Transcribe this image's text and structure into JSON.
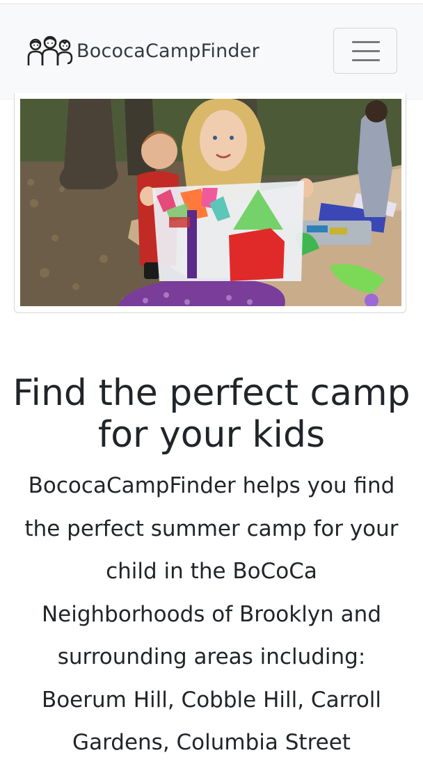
{
  "navbar": {
    "brand_name": "BococaCampFinder",
    "logo_icon": "family-icon",
    "menu_icon": "hamburger-icon"
  },
  "hero": {
    "image_alt": "Child holding a tissue paper collage at a picnic table",
    "title": "Find the perfect camp for your kids",
    "description": "BococaCampFinder helps you find the perfect summer camp for your child in the BoCoCa Neighborhoods of Brooklyn and surrounding areas including: Boerum Hill, Cobble Hill, Carroll Gardens, Columbia Street"
  },
  "colors": {
    "navbar_bg": "#f8f9fa",
    "text": "#212529"
  }
}
